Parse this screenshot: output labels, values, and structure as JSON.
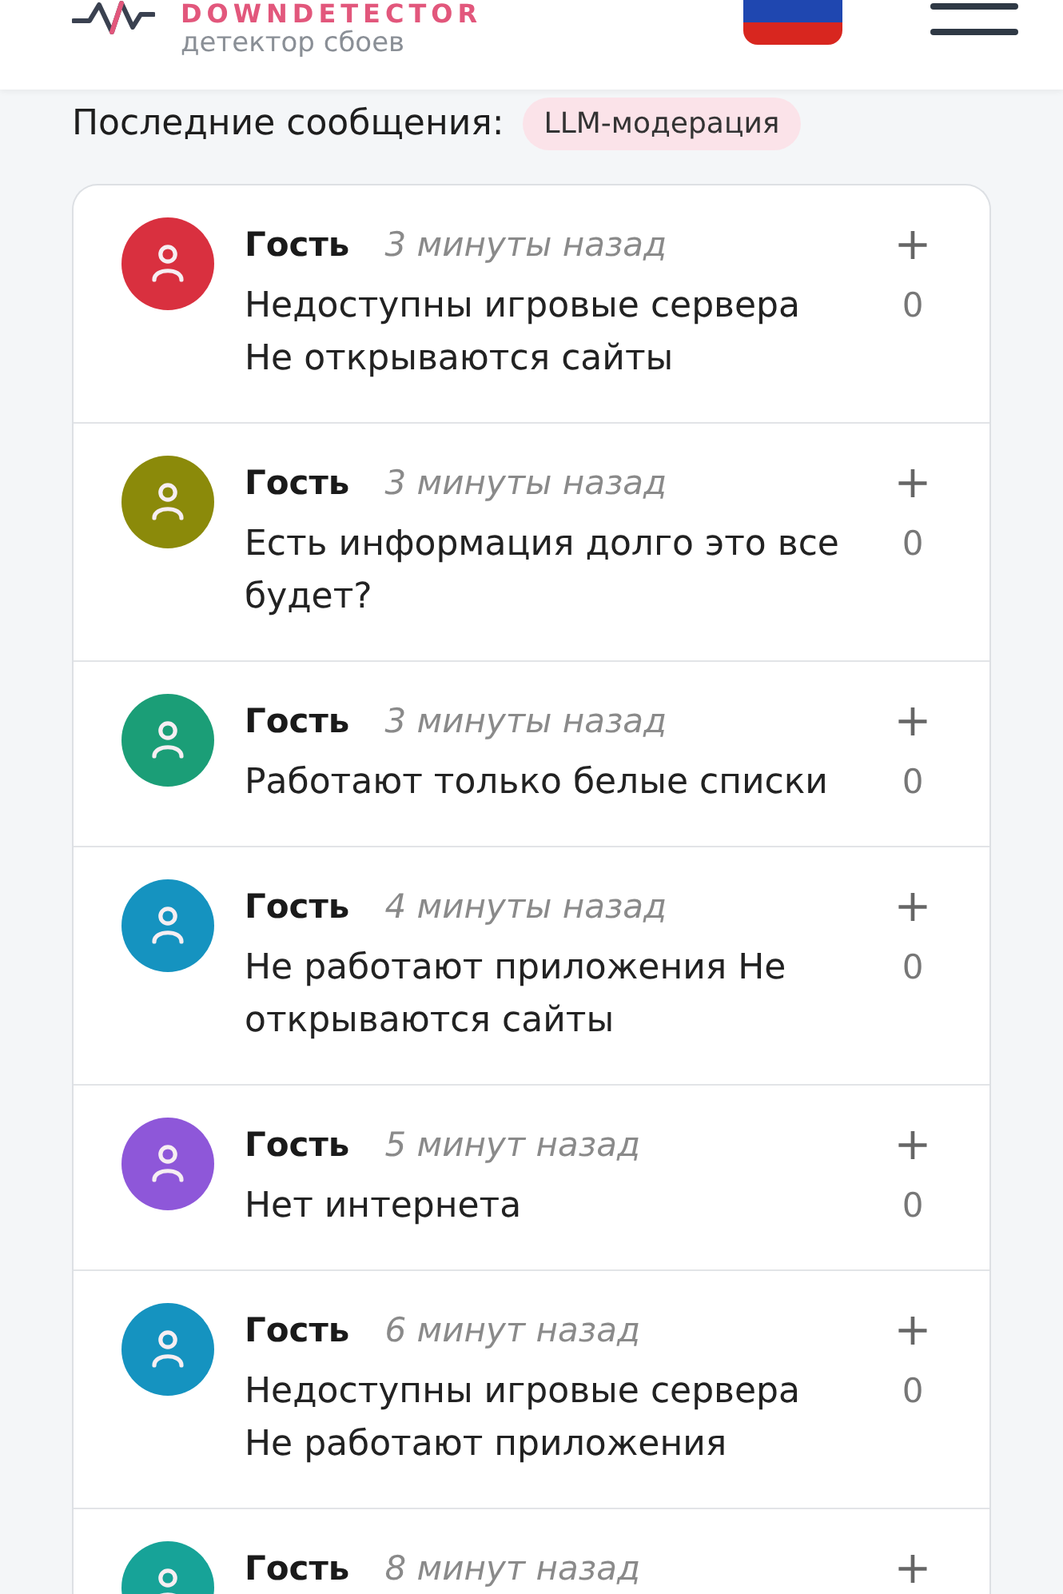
{
  "header": {
    "logo_title": "DOWNDETECTOR",
    "logo_subtitle": "детектор сбоев"
  },
  "section": {
    "title": "Последние сообщения:",
    "tag": "LLM-модерация"
  },
  "messages": [
    {
      "author": "Гость",
      "time": "3 минуты назад",
      "text": "Недоступны игровые сервера Не открываются сайты",
      "color": "#d9303f",
      "vote": "+",
      "count": "0"
    },
    {
      "author": "Гость",
      "time": "3 минуты назад",
      "text": "Есть информация долго это все будет?",
      "color": "#8b8a0a",
      "vote": "+",
      "count": "0"
    },
    {
      "author": "Гость",
      "time": "3 минуты назад",
      "text": "Работают только белые списки",
      "color": "#1b9e77",
      "vote": "+",
      "count": "0"
    },
    {
      "author": "Гость",
      "time": "4 минуты назад",
      "text": "Не работают приложения Не открываются сайты",
      "color": "#1593c0",
      "vote": "+",
      "count": "0"
    },
    {
      "author": "Гость",
      "time": "5 минут назад",
      "text": "Нет интернета",
      "color": "#8e57d9",
      "vote": "+",
      "count": "0"
    },
    {
      "author": "Гость",
      "time": "6 минут назад",
      "text": "Недоступны игровые сервера Не работают приложения",
      "color": "#1593c0",
      "vote": "+",
      "count": "0"
    },
    {
      "author": "Гость",
      "time": "8 минут назад",
      "color": "#17a398",
      "vote": "+"
    }
  ]
}
